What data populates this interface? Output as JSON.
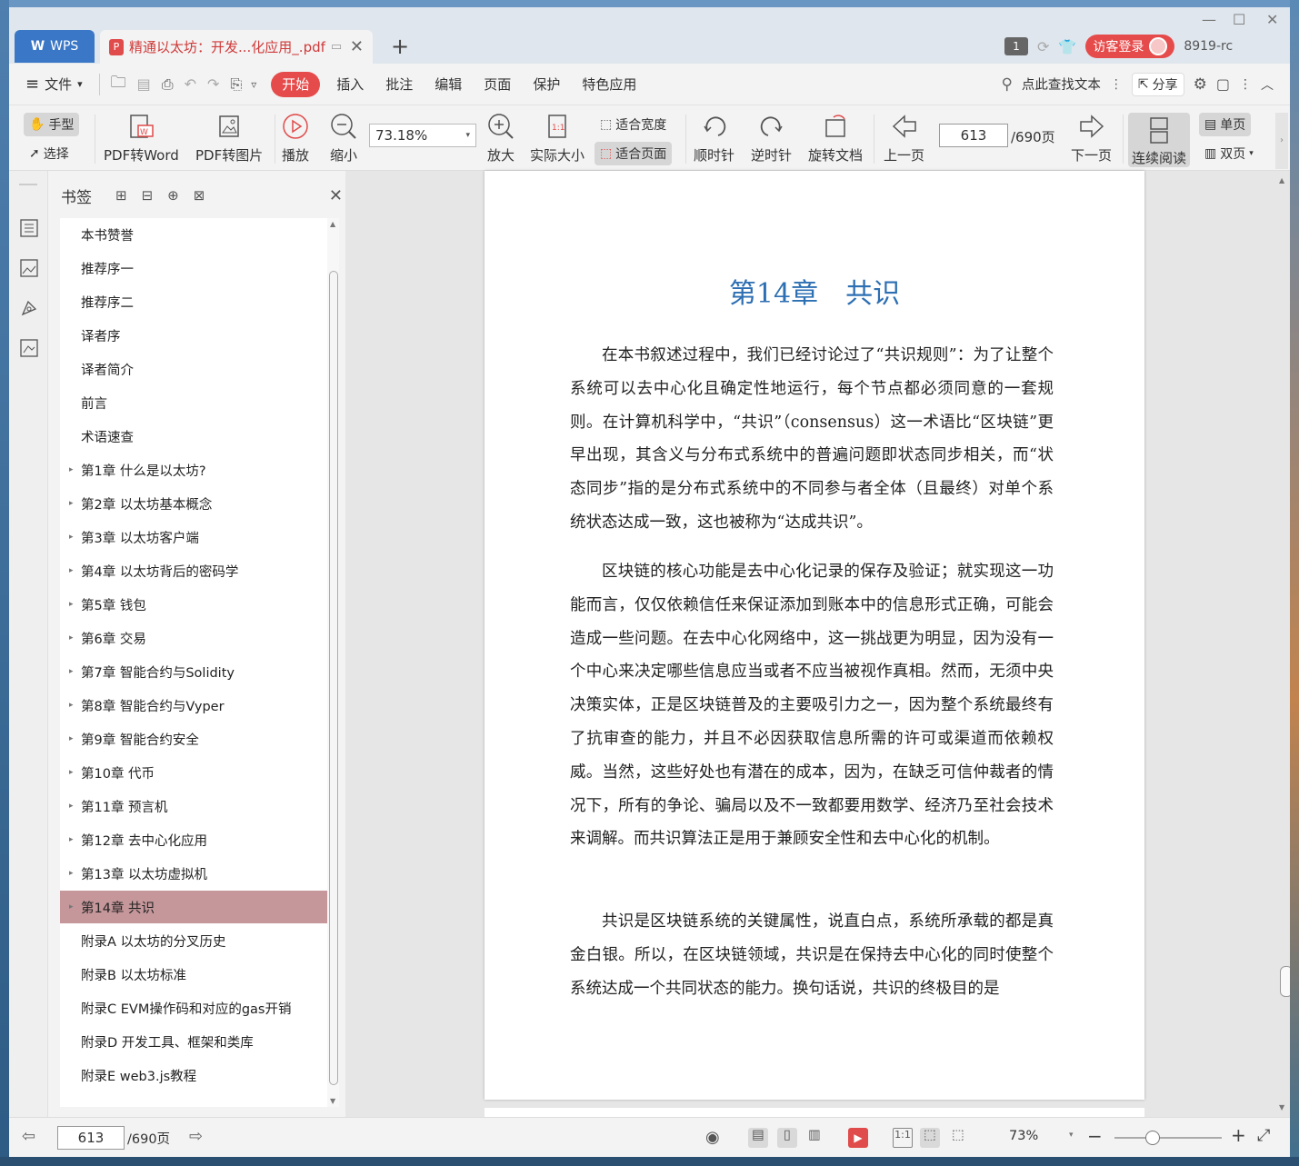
{
  "titlebar": {
    "wps_tab": "WPS",
    "doc_tab": "精通以太坊：开发...化应用_.pdf",
    "badge": "1",
    "login": "访客登录",
    "user": "8919-rc"
  },
  "menubar": {
    "file": "文件",
    "tabs": [
      "开始",
      "插入",
      "批注",
      "编辑",
      "页面",
      "保护",
      "特色应用"
    ],
    "search": "点此查找文本",
    "share": "分享"
  },
  "toolbar": {
    "hand": "手型",
    "select": "选择",
    "pdf_word": "PDF转Word",
    "pdf_img": "PDF转图片",
    "play": "播放",
    "zoom_out": "缩小",
    "zoom_value": "73.18%",
    "zoom_in": "放大",
    "actual": "实际大小",
    "fit_width": "适合宽度",
    "fit_page": "适合页面",
    "cw": "顺时针",
    "ccw": "逆时针",
    "rotate": "旋转文档",
    "prev": "上一页",
    "page": "613",
    "total": "/690页",
    "next": "下一页",
    "continuous": "连续阅读",
    "single": "单页",
    "double": "双页"
  },
  "sidebar": {
    "title": "书签",
    "bookmarks": [
      {
        "label": "本书赞誉",
        "expandable": false
      },
      {
        "label": "推荐序一",
        "expandable": false
      },
      {
        "label": "推荐序二",
        "expandable": false
      },
      {
        "label": "译者序",
        "expandable": false
      },
      {
        "label": "译者简介",
        "expandable": false
      },
      {
        "label": "前言",
        "expandable": false
      },
      {
        "label": "术语速查",
        "expandable": false
      },
      {
        "label": "第1章 什么是以太坊?",
        "expandable": true
      },
      {
        "label": "第2章 以太坊基本概念",
        "expandable": true
      },
      {
        "label": "第3章 以太坊客户端",
        "expandable": true
      },
      {
        "label": "第4章 以太坊背后的密码学",
        "expandable": true
      },
      {
        "label": "第5章 钱包",
        "expandable": true
      },
      {
        "label": "第6章 交易",
        "expandable": true
      },
      {
        "label": "第7章 智能合约与Solidity",
        "expandable": true
      },
      {
        "label": "第8章 智能合约与Vyper",
        "expandable": true
      },
      {
        "label": "第9章 智能合约安全",
        "expandable": true
      },
      {
        "label": "第10章 代币",
        "expandable": true
      },
      {
        "label": "第11章 预言机",
        "expandable": true
      },
      {
        "label": "第12章 去中心化应用",
        "expandable": true
      },
      {
        "label": "第13章 以太坊虚拟机",
        "expandable": true
      },
      {
        "label": "第14章 共识",
        "expandable": true,
        "active": true
      },
      {
        "label": "附录A 以太坊的分叉历史",
        "expandable": false
      },
      {
        "label": "附录B 以太坊标准",
        "expandable": false
      },
      {
        "label": "附录C EVM操作码和对应的gas开销",
        "expandable": false
      },
      {
        "label": "附录D 开发工具、框架和类库",
        "expandable": false
      },
      {
        "label": "附录E web3.js教程",
        "expandable": false
      }
    ]
  },
  "document": {
    "chapter_title": "第14章　共识",
    "paragraphs": [
      "在本书叙述过程中，我们已经讨论过了“共识规则”：为了让整个系统可以去中心化且确定性地运行，每个节点都必须同意的一套规则。在计算机科学中，“共识”（consensus）这一术语比“区块链”更早出现，其含义与分布式系统中的普遍问题即状态同步相关，而“状态同步”指的是分布式系统中的不同参与者全体（且最终）对单个系统状态达成一致，这也被称为“达成共识”。",
      "区块链的核心功能是去中心化记录的保存及验证；就实现这一功能而言，仅仅依赖信任来保证添加到账本中的信息形式正确，可能会造成一些问题。在去中心化网络中，这一挑战更为明显，因为没有一个中心来决定哪些信息应当或者不应当被视作真相。然而，无须中央决策实体，正是区块链普及的主要吸引力之一，因为整个系统最终有了抗审查的能力，并且不必因获取信息所需的许可或渠道而依赖权威。当然，这些好处也有潜在的成本，因为，在缺乏可信仲裁者的情况下，所有的争论、骗局以及不一致都要用数学、经济乃至社会技术来调解。而共识算法正是用于兼顾安全性和去中心化的机制。",
      "共识是区块链系统的关键属性，说直白点，系统所承载的都是真金白银。所以，在区块链领域，共识是在保持去中心化的同时使整个系统达成一个共同状态的能力。换句话说，共识的终极目的是"
    ]
  },
  "statusbar": {
    "page": "613",
    "total": "/690页",
    "zoom": "73%"
  },
  "colors": {
    "accent": "#e64b4b",
    "title_blue": "#2d6fb3",
    "active_bookmark": "#c5979b"
  }
}
